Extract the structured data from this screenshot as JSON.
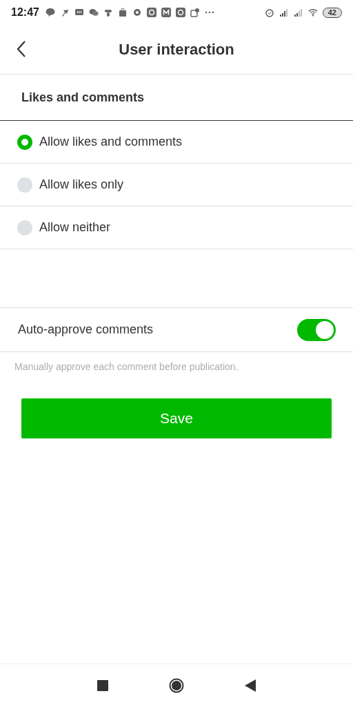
{
  "status_bar": {
    "time": "12:47",
    "battery": "42"
  },
  "header": {
    "title": "User interaction"
  },
  "section": {
    "title": "Likes and comments"
  },
  "options": [
    {
      "label": "Allow likes and comments",
      "selected": true
    },
    {
      "label": "Allow likes only",
      "selected": false
    },
    {
      "label": "Allow neither",
      "selected": false
    }
  ],
  "setting": {
    "label": "Auto-approve comments",
    "on": true,
    "hint": "Manually approve each comment before publication."
  },
  "button": "Save"
}
